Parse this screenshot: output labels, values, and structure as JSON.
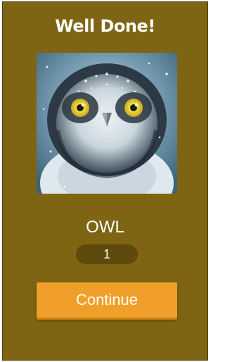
{
  "header": {
    "title": "Well Done!"
  },
  "puzzle": {
    "image_subject": "owl",
    "answer": "OWL",
    "score": "1"
  },
  "actions": {
    "continue_label": "Continue"
  },
  "colors": {
    "background": "#7f6513",
    "score_pill": "#5e4a0c",
    "button": "#f0a02a",
    "text": "#ffffff"
  }
}
